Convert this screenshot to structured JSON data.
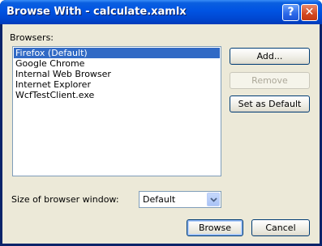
{
  "window": {
    "title": "Browse With - calculate.xamlx",
    "help_glyph": "?",
    "close_glyph": "✕"
  },
  "browsers": {
    "label": "Browsers:",
    "items": [
      {
        "label": "Firefox (Default)",
        "selected": true
      },
      {
        "label": "Google Chrome",
        "selected": false
      },
      {
        "label": "Internal Web Browser",
        "selected": false
      },
      {
        "label": "Internet Explorer",
        "selected": false
      },
      {
        "label": "WcfTestClient.exe",
        "selected": false
      }
    ]
  },
  "buttons": {
    "add": "Add...",
    "remove": "Remove",
    "set_default": "Set as Default",
    "browse": "Browse",
    "cancel": "Cancel"
  },
  "size": {
    "label": "Size of browser window:",
    "value": "Default"
  },
  "colors": {
    "titlebar": "#0053e2",
    "client": "#ece9d8",
    "selection": "#316ac5",
    "close_button": "#d4471f"
  }
}
